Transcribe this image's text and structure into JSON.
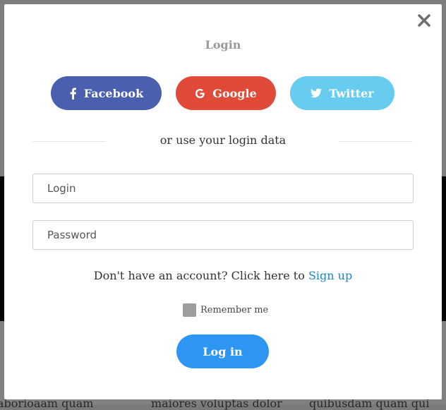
{
  "modal": {
    "title": "Login",
    "social": {
      "facebook_label": "Facebook",
      "google_label": "Google",
      "twitter_label": "Twitter"
    },
    "divider_text": "or use your login data",
    "login_placeholder": "Login",
    "password_placeholder": "Password",
    "signup_prompt": "Don't have an account? Click here to",
    "signup_link": "Sign up",
    "remember_label": "Remember me",
    "login_button": "Log in"
  },
  "background": {
    "snippet_1": "maiores voluptas dolor",
    "snippet_2": "quibusdam quam qui",
    "snippet_3": "aborioaam quam"
  },
  "colors": {
    "facebook": "#4a5fae",
    "google": "#df4b38",
    "twitter": "#68ccf0",
    "primary": "#2e96f2",
    "link": "#1a86c9"
  },
  "icons": {
    "close": "close-icon",
    "facebook": "facebook-icon",
    "google": "google-icon",
    "twitter": "twitter-icon"
  }
}
